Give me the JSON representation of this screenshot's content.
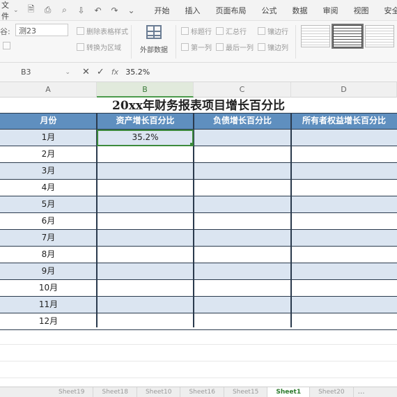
{
  "menubar": {
    "file_label": "文件",
    "tabs": [
      "开始",
      "插入",
      "页面布局",
      "公式",
      "数据",
      "审阅",
      "视图",
      "安全"
    ]
  },
  "ribbon": {
    "style_label": "谷:",
    "style_name_value": "测23",
    "buttons": {
      "delete_style": "删除表格样式",
      "convert_to_range": "转换为区域",
      "external_data": "外部数据",
      "header_row": "标题行",
      "total_row": "汇总行",
      "banded_rows": "镶边行",
      "first_column": "第一列",
      "last_column": "最后一列",
      "banded_columns": "镶边列"
    }
  },
  "formula_bar": {
    "cell_ref": "B3",
    "fx": "fx",
    "value": "35.2%"
  },
  "columns": [
    "A",
    "B",
    "C",
    "D"
  ],
  "sheet": {
    "title": "20xx年财务报表项目增长百分比",
    "headers": [
      "月份",
      "资产增长百分比",
      "负债增长百分比",
      "所有者权益增长百分比"
    ],
    "rows": [
      [
        "1月",
        "35.2%",
        "",
        ""
      ],
      [
        "2月",
        "",
        "",
        ""
      ],
      [
        "3月",
        "",
        "",
        ""
      ],
      [
        "4月",
        "",
        "",
        ""
      ],
      [
        "5月",
        "",
        "",
        ""
      ],
      [
        "6月",
        "",
        "",
        ""
      ],
      [
        "7月",
        "",
        "",
        ""
      ],
      [
        "8月",
        "",
        "",
        ""
      ],
      [
        "9月",
        "",
        "",
        ""
      ],
      [
        "10月",
        "",
        "",
        ""
      ],
      [
        "11月",
        "",
        "",
        ""
      ],
      [
        "12月",
        "",
        "",
        ""
      ]
    ]
  },
  "sheet_tabs": [
    "Sheet19",
    "Sheet18",
    "Sheet10",
    "Sheet16",
    "Sheet15",
    "Sheet1",
    "Sheet20"
  ],
  "active_sheet_tab": "Sheet1",
  "colors": {
    "header_fill": "#5f8fbf",
    "band_fill": "#dbe5f1",
    "selection": "#3c8a3c"
  }
}
